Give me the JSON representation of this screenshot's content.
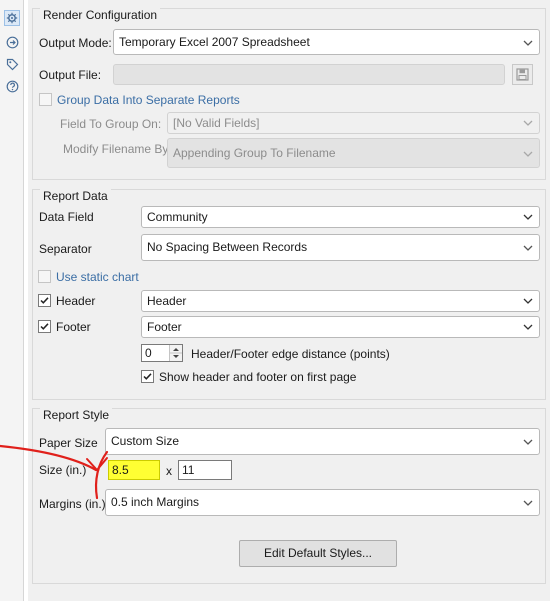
{
  "strip": {
    "icons": [
      "configuration-icon",
      "input-icon",
      "tag-icon",
      "help-icon"
    ]
  },
  "render": {
    "title": "Render Configuration",
    "output_mode_label": "Output Mode:",
    "output_mode_value": "Temporary Excel 2007 Spreadsheet",
    "output_file_label": "Output File:",
    "output_file_value": "",
    "group_reports_label": "Group Data Into Separate Reports",
    "group_reports_checked": false,
    "field_group_label": "Field To Group On:",
    "field_group_value": "[No Valid Fields]",
    "modify_filename_label": "Modify Filename By:",
    "modify_filename_value": "Appending Group To Filename"
  },
  "report_data": {
    "title": "Report Data",
    "data_field_label": "Data Field",
    "data_field_value": "Community",
    "separator_label": "Separator",
    "separator_value": "No Spacing Between Records",
    "static_chart_label": "Use static chart",
    "static_chart_checked": false,
    "header_label": "Header",
    "header_checked": true,
    "header_value": "Header",
    "footer_label": "Footer",
    "footer_checked": true,
    "footer_value": "Footer",
    "edge_distance_value": "0",
    "edge_distance_label": "Header/Footer edge distance (points)",
    "show_first_page_label": "Show header and footer on first page",
    "show_first_page_checked": true
  },
  "report_style": {
    "title": "Report Style",
    "paper_size_label": "Paper Size",
    "paper_size_value": "Custom Size",
    "size_label": "Size (in.)",
    "width_value": "8.5",
    "times": "x",
    "height_value": "11",
    "margins_label": "Margins (in.)",
    "margins_value": "0.5 inch Margins",
    "edit_styles_button": "Edit Default Styles..."
  },
  "colors": {
    "annotation": "#e0201b",
    "highlight": "#ffff33"
  }
}
